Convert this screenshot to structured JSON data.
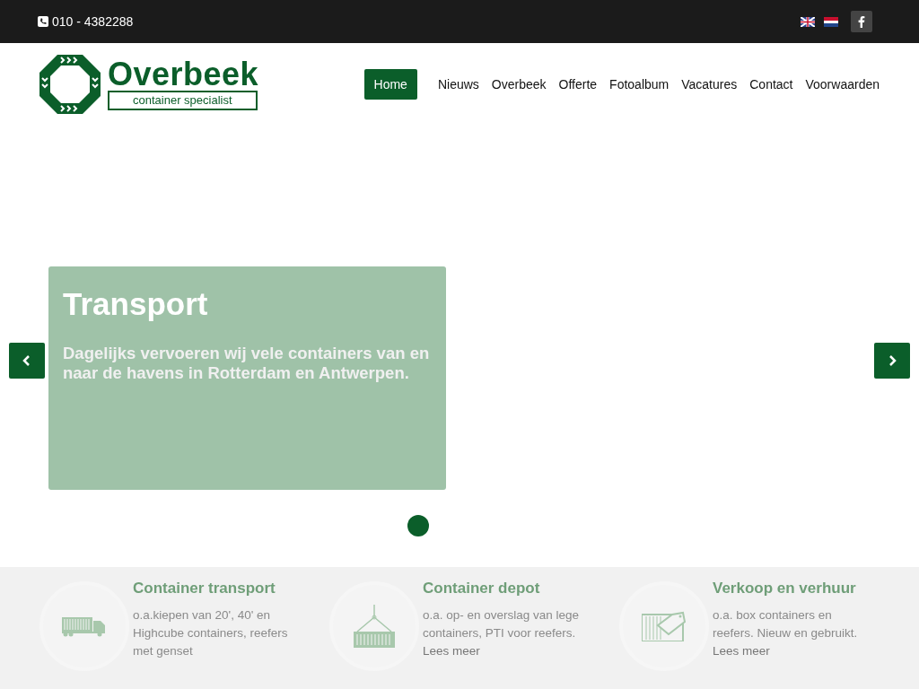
{
  "topbar": {
    "phone": "010 - 4382288"
  },
  "logo": {
    "name": "Overbeek",
    "tagline": "container specialist"
  },
  "nav": [
    {
      "label": "Home",
      "selected": true
    },
    {
      "label": "Nieuws",
      "selected": false
    },
    {
      "label": "Overbeek",
      "selected": false
    },
    {
      "label": "Offerte",
      "selected": false
    },
    {
      "label": "Fotoalbum",
      "selected": false
    },
    {
      "label": "Vacatures",
      "selected": false
    },
    {
      "label": "Contact",
      "selected": false
    },
    {
      "label": "Voorwaarden",
      "selected": false
    }
  ],
  "slide": {
    "title": "Transport",
    "text": "Dagelijks vervoeren wij vele containers van en naar de havens in  Rotterdam en Antwerpen."
  },
  "dots": [
    {
      "selected": true
    }
  ],
  "features": [
    {
      "kind": "truck",
      "title": "Container transport",
      "text": "o.a.kiepen van 20', 40' en Highcube containers, reefers met genset"
    },
    {
      "kind": "crane",
      "title": "Container depot",
      "text": "o.a. op- en overslag van lege containers, PTI voor reefers.",
      "link": "Lees meer"
    },
    {
      "kind": "tag",
      "title": "Verkoop en verhuur",
      "text": "o.a. box containers en reefers. Nieuw en gebruikt.",
      "link": "Lees meer"
    }
  ]
}
